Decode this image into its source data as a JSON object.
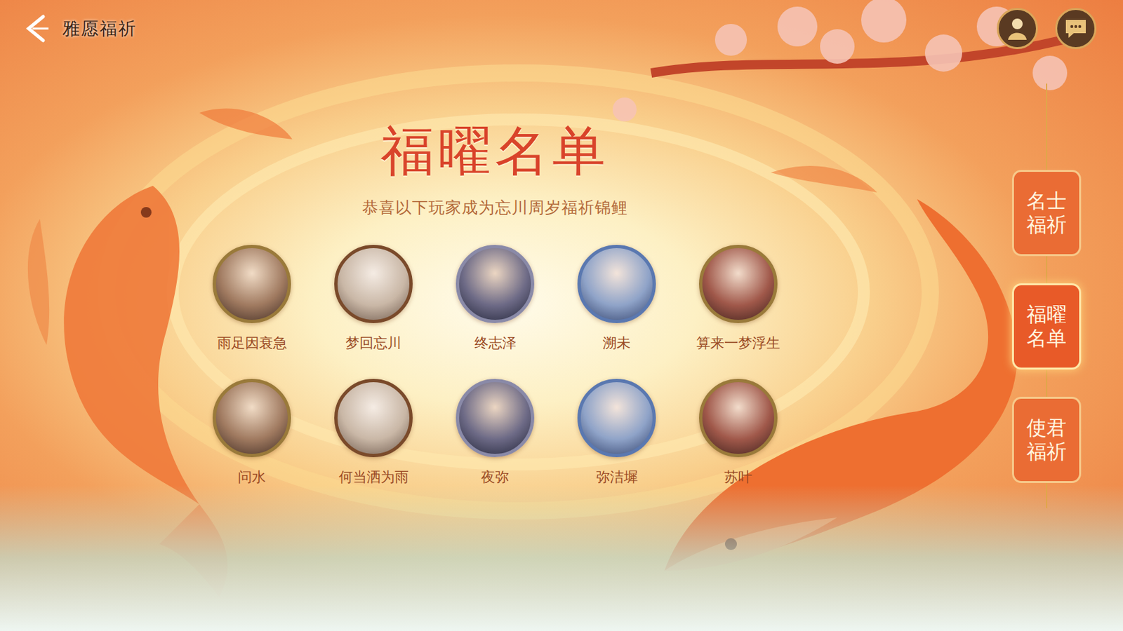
{
  "header": {
    "title": "雅愿福祈"
  },
  "panel": {
    "title": "福曜名单",
    "subtitle": "恭喜以下玩家成为忘川周岁福祈锦鲤"
  },
  "winners": [
    {
      "name": "雨足因衰急"
    },
    {
      "name": "梦回忘川"
    },
    {
      "name": "终志泽"
    },
    {
      "name": "溯未"
    },
    {
      "name": "算来一梦浮生"
    },
    {
      "name": "问水"
    },
    {
      "name": "何当洒为雨"
    },
    {
      "name": "夜弥"
    },
    {
      "name": "弥洁墀"
    },
    {
      "name": "苏叶"
    }
  ],
  "side_tabs": [
    {
      "label": "名士福祈",
      "selected": false
    },
    {
      "label": "福曜名单",
      "selected": true
    },
    {
      "label": "使君福祈",
      "selected": false
    }
  ]
}
